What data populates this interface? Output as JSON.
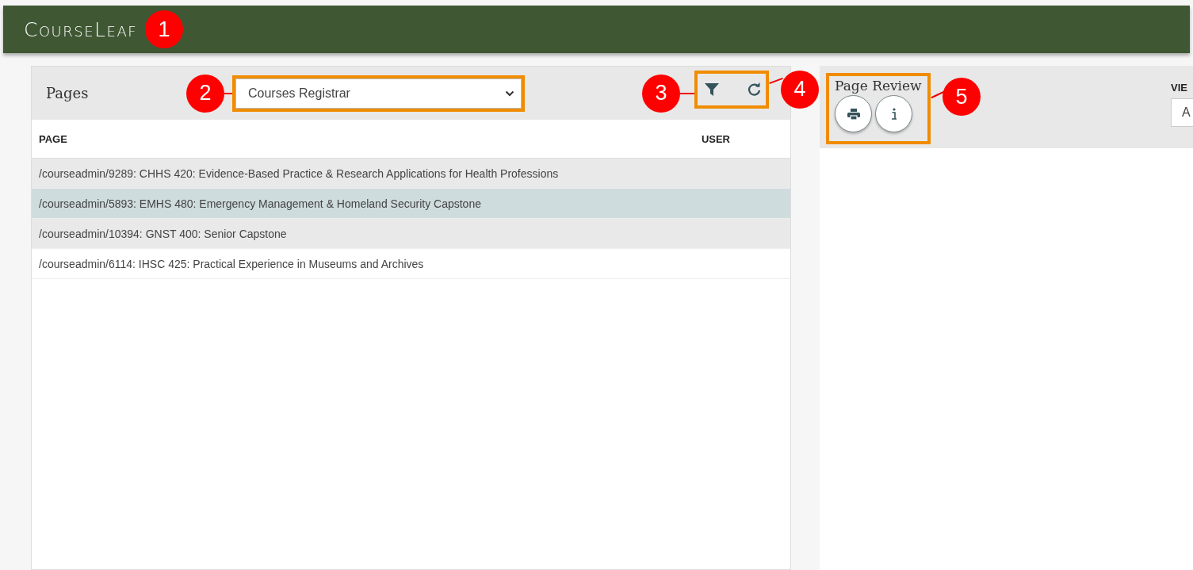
{
  "header": {
    "logo": "CourseLeaf",
    "callout": "1"
  },
  "pages_panel": {
    "title": "Pages",
    "dropdown": {
      "value": "Courses Registrar",
      "callout": "2"
    },
    "filter_callout": "3",
    "refresh_callout": "4",
    "columns": [
      "PAGE",
      "USER"
    ],
    "rows": [
      {
        "page": "/courseadmin/9289: CHHS 420: Evidence-Based Practice & Research Applications for Health Professions",
        "selected": false
      },
      {
        "page": "/courseadmin/5893: EMHS 480: Emergency Management & Homeland Security Capstone",
        "selected": true
      },
      {
        "page": "/courseadmin/10394: GNST 400: Senior Capstone",
        "selected": false
      },
      {
        "page": "/courseadmin/6114: IHSC 425: Practical Experience in Museums and Archives",
        "selected": false
      }
    ]
  },
  "review_panel": {
    "title": "Page Review",
    "callout": "5",
    "view_label": "VIE",
    "view_field": "A"
  }
}
